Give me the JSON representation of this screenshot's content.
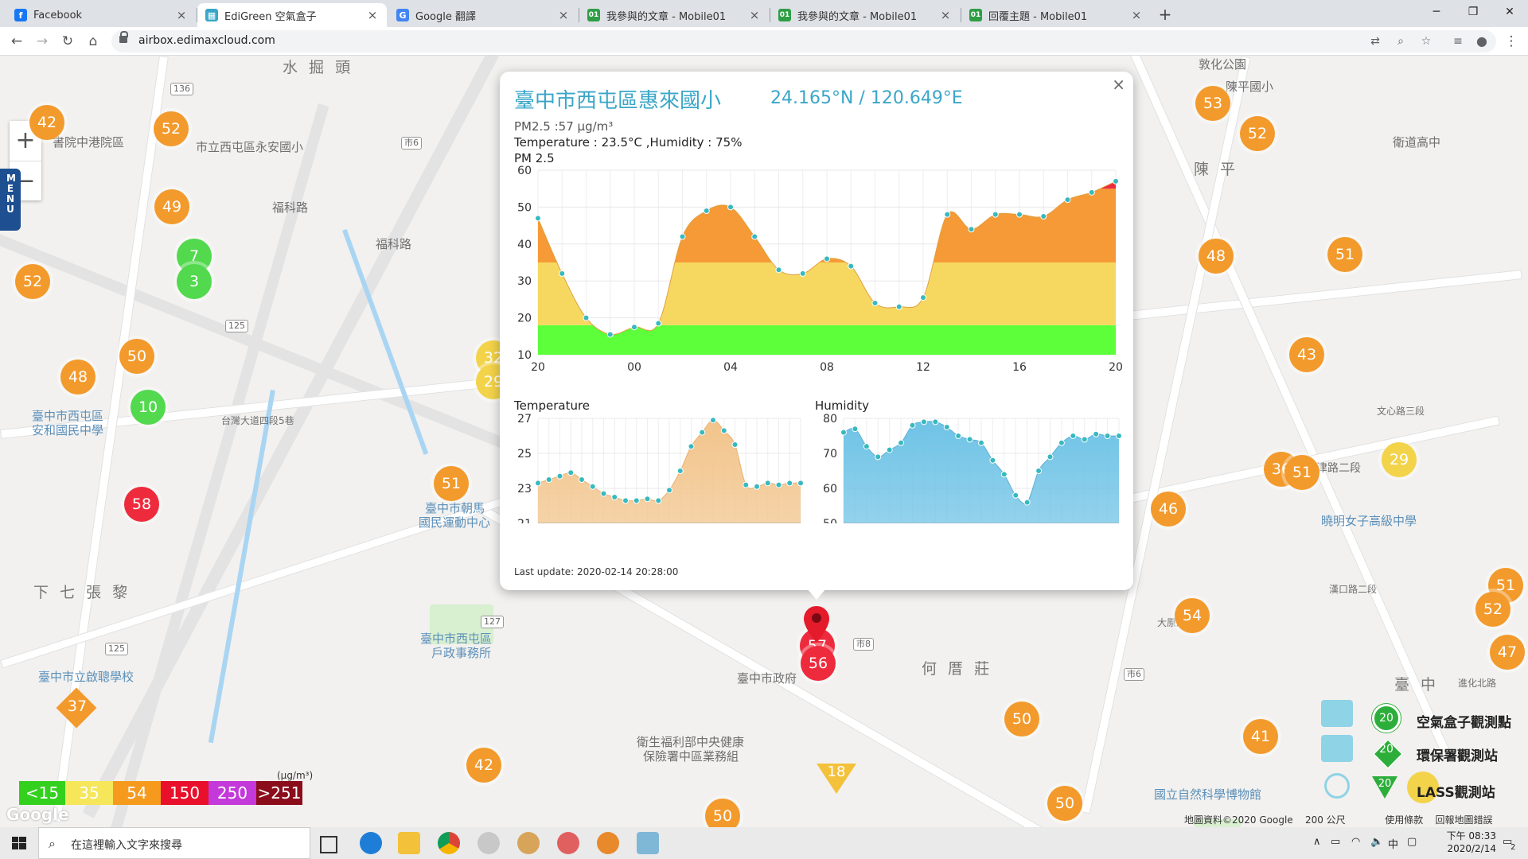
{
  "browser": {
    "tabs": [
      {
        "title": "Facebook",
        "icon": "facebook-icon",
        "color": "#1877f2",
        "glyph": "f",
        "active": false
      },
      {
        "title": "EdiGreen 空氣盒子",
        "icon": "edigreen-icon",
        "color": "#3aa6c8",
        "glyph": "▦",
        "active": true
      },
      {
        "title": "Google 翻譯",
        "icon": "google-translate-icon",
        "color": "#4285f4",
        "glyph": "G",
        "active": false
      },
      {
        "title": "我參與的文章 - Mobile01",
        "icon": "mobile01-icon",
        "color": "#2e9e45",
        "glyph": "01",
        "active": false
      },
      {
        "title": "我參與的文章 - Mobile01",
        "icon": "mobile01-icon",
        "color": "#2e9e45",
        "glyph": "01",
        "active": false
      },
      {
        "title": "回覆主題 - Mobile01",
        "icon": "mobile01-icon",
        "color": "#2e9e45",
        "glyph": "01",
        "active": false
      }
    ],
    "url": "airbox.edimaxcloud.com"
  },
  "map": {
    "place_labels": [
      {
        "text": "水 掘 頭",
        "big": true
      },
      {
        "text": "書院中港院區"
      },
      {
        "text": "市立西屯區永安國小"
      },
      {
        "text": "福科路"
      },
      {
        "text": "福科路"
      },
      {
        "text": "臺中市西屯區"
      },
      {
        "text": "安和國民中學"
      },
      {
        "text": "臺中市朝馬"
      },
      {
        "text": "國民運動中心"
      },
      {
        "text": "下 七 張 黎",
        "big": true
      },
      {
        "text": "臺中市西屯區"
      },
      {
        "text": "戶政事務所"
      },
      {
        "text": "臺中市立啟聰學校"
      },
      {
        "text": "臺中市政府"
      },
      {
        "text": "衛生福利部中央健康"
      },
      {
        "text": "保險署中區業務組"
      },
      {
        "text": "何 厝 莊",
        "big": true
      },
      {
        "text": "敦化公園"
      },
      {
        "text": "陳平國小"
      },
      {
        "text": "衛道高中"
      },
      {
        "text": "陳 平",
        "big": true
      },
      {
        "text": "曉明女子高級中學"
      },
      {
        "text": "國立自然科學博物館"
      },
      {
        "text": "臺 中",
        "big": true
      },
      {
        "text": "進化北路"
      },
      {
        "text": "台灣大道四段5巷"
      },
      {
        "text": "漢口路二段"
      },
      {
        "text": "大原路"
      },
      {
        "text": "文心路三段"
      },
      {
        "text": "天津路二段"
      }
    ],
    "markers_orange": [
      "42",
      "52",
      "49",
      "52",
      "50",
      "48",
      "51",
      "53",
      "52",
      "48",
      "51",
      "43",
      "36",
      "51",
      "46",
      "54",
      "50",
      "51",
      "52",
      "47",
      "41",
      "50",
      "42",
      "50"
    ],
    "markers_green": [
      "7",
      "3",
      "10"
    ],
    "markers_red": [
      "58",
      "57",
      "56"
    ],
    "markers_yellow": [
      "32",
      "29",
      "29"
    ],
    "diamond_value": "37",
    "triangle_value": "18",
    "menu_label": "MENU",
    "zoom_in": "+",
    "zoom_out": "−"
  },
  "popup": {
    "close": "×",
    "title": "臺中市西屯區惠來國小",
    "coords": "24.165°N / 120.649°E",
    "pm25_line": "PM2.5 :57 μg/m³",
    "env_line": "Temperature : 23.5°C ,Humidity : 75%",
    "chart_title": "PM 2.5",
    "temp_title": "Temperature",
    "hum_title": "Humidity",
    "last_update": "Last update: 2020-02-14 20:28:00"
  },
  "chart_data": [
    {
      "type": "area",
      "title": "PM 2.5",
      "x_ticks": [
        "20",
        "00",
        "04",
        "08",
        "12",
        "16",
        "20"
      ],
      "ylim": [
        10,
        60
      ],
      "y_ticks": [
        10,
        20,
        30,
        40,
        50,
        60
      ],
      "bands": [
        {
          "from": 10,
          "to": 18,
          "color": "#5cff3a"
        },
        {
          "from": 18,
          "to": 35,
          "color": "#f6d861"
        },
        {
          "from": 35,
          "to": 55,
          "color": "#f59a36"
        },
        {
          "from": 55,
          "to": 60,
          "color": "#ee2b3d"
        }
      ],
      "values": [
        47,
        32,
        20,
        15.5,
        17.5,
        18.5,
        42,
        49,
        50,
        42,
        33,
        32,
        36,
        34,
        24,
        23,
        25.5,
        48,
        44,
        48,
        48,
        47.5,
        52,
        54,
        57
      ]
    },
    {
      "type": "area",
      "title": "Temperature",
      "ylim": [
        21,
        27
      ],
      "y_ticks": [
        21,
        23,
        25,
        27
      ],
      "color": "#f2c48b",
      "values": [
        23.3,
        23.5,
        23.7,
        23.9,
        23.5,
        23.1,
        22.7,
        22.5,
        22.3,
        22.3,
        22.4,
        22.3,
        22.9,
        24.0,
        25.4,
        26.2,
        26.9,
        26.3,
        25.5,
        23.2,
        23.1,
        23.3,
        23.2,
        23.3,
        23.3
      ]
    },
    {
      "type": "area",
      "title": "Humidity",
      "ylim": [
        50,
        80
      ],
      "y_ticks": [
        50,
        60,
        70,
        80
      ],
      "color": "#6fc3e6",
      "values": [
        76,
        77,
        72,
        69,
        71,
        73,
        78,
        79,
        79,
        77.5,
        75,
        74,
        73,
        68,
        64,
        58,
        56,
        65,
        69,
        73,
        75,
        74,
        75.5,
        75,
        75
      ]
    }
  ],
  "aqi_legend": {
    "unit": "(μg/m³)",
    "cells": [
      {
        "label": "<15",
        "color": "#33d11e"
      },
      {
        "label": "35",
        "color": "#f5e65a"
      },
      {
        "label": "54",
        "color": "#f59a1d"
      },
      {
        "label": "150",
        "color": "#e8102a"
      },
      {
        "label": "250",
        "color": "#c339d9"
      },
      {
        "label": ">251",
        "color": "#8b0d1b"
      }
    ]
  },
  "station_legend": [
    {
      "value": "20",
      "label": "空氣盒子觀測點",
      "icon": "airbox-station-icon"
    },
    {
      "value": "20",
      "label": "環保署觀測站",
      "icon": "epa-station-icon"
    },
    {
      "value": "20",
      "label": "LASS觀測站",
      "icon": "lass-station-icon"
    }
  ],
  "map_credit": {
    "copyright": "地圖資料©2020 Google",
    "scale": "200 公尺",
    "terms": "使用條款",
    "report": "回報地圖錯誤"
  },
  "google_logo": "Google",
  "taskbar": {
    "search_placeholder": "在這裡輸入文字來搜尋",
    "time": "下午 08:33",
    "date": "2020/2/14",
    "ime": "中",
    "notifications": "2"
  }
}
